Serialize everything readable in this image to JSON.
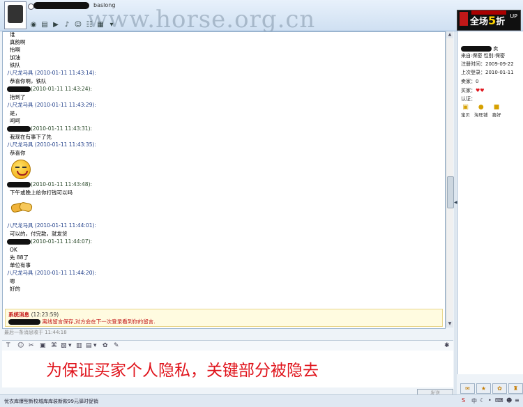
{
  "window": {
    "title_suffix": "baslong",
    "watermark": "www.horse.org.cn"
  },
  "ad": {
    "text_prefix": "全场",
    "text_num": "5",
    "text_suffix": "折",
    "badge_text": "UP"
  },
  "history": {
    "messages": [
      {
        "header": "",
        "lines": [
          "谁",
          "真韵啊",
          "抬啊",
          "加油",
          "铁队"
        ]
      },
      {
        "header": "八尺龙马具 (2010-01-11 11:43:14):",
        "lines": [
          "恭喜你啊，铁队"
        ]
      },
      {
        "header": "(2010-01-11 11:43:24):",
        "masked": true,
        "lines": [
          "抬到了"
        ]
      },
      {
        "header": "八尺龙马具 (2010-01-11 11:43:29):",
        "lines": [
          "是，",
          "呵呵"
        ]
      },
      {
        "header": "(2010-01-11 11:43:31):",
        "masked": true,
        "lines": [
          "我现在有事下了先"
        ]
      },
      {
        "header": "八尺龙马具 (2010-01-11 11:43:35):",
        "lines": [
          "恭喜你"
        ],
        "emoji": "smile-emoji"
      },
      {
        "header": "(2010-01-11 11:43:48):",
        "masked": true,
        "lines": [
          "下午或晚上给你打钱可以吗"
        ],
        "emoji": "handshake-emoji"
      },
      {
        "header": "八尺龙马具 (2010-01-11 11:44:01):",
        "lines": [
          "可以的，付完款，就发货"
        ]
      },
      {
        "header": "(2010-01-11 11:44:07):",
        "masked": true,
        "lines": [
          "OK",
          "先 88了",
          "单位有事"
        ]
      },
      {
        "header": "八尺龙马具 (2010-01-11 11:44:20):",
        "lines": [
          "嗯",
          "好的"
        ]
      }
    ],
    "system": {
      "title": "系统消息",
      "time": "(12:23:59)",
      "body": "离线留言保存,对方会在下一次登录看到你的留言."
    },
    "last_msg": "最后一条消息收于 11:44:18"
  },
  "compose": {
    "overlay": "为保证买家个人隐私，关键部分被隐去",
    "send_label": "发送"
  },
  "statusbar": {
    "text": "忧衣库爆型新校城库库装新款99元驿时促销"
  },
  "seller": {
    "label_prefix": "卖",
    "id_line": "来自:保密   性别:保密",
    "reg_time": "注册时间：2009-09-22",
    "last_login": "上次登录：2010-01-11",
    "seller_rate": "卖家：0",
    "buyer_rate": "买家：",
    "cert": "认证：",
    "icons": [
      {
        "name": "宝贝",
        "glyph": "▣"
      },
      {
        "name": "淘旺铺",
        "glyph": "●"
      },
      {
        "name": "喜好",
        "glyph": "■"
      }
    ]
  }
}
